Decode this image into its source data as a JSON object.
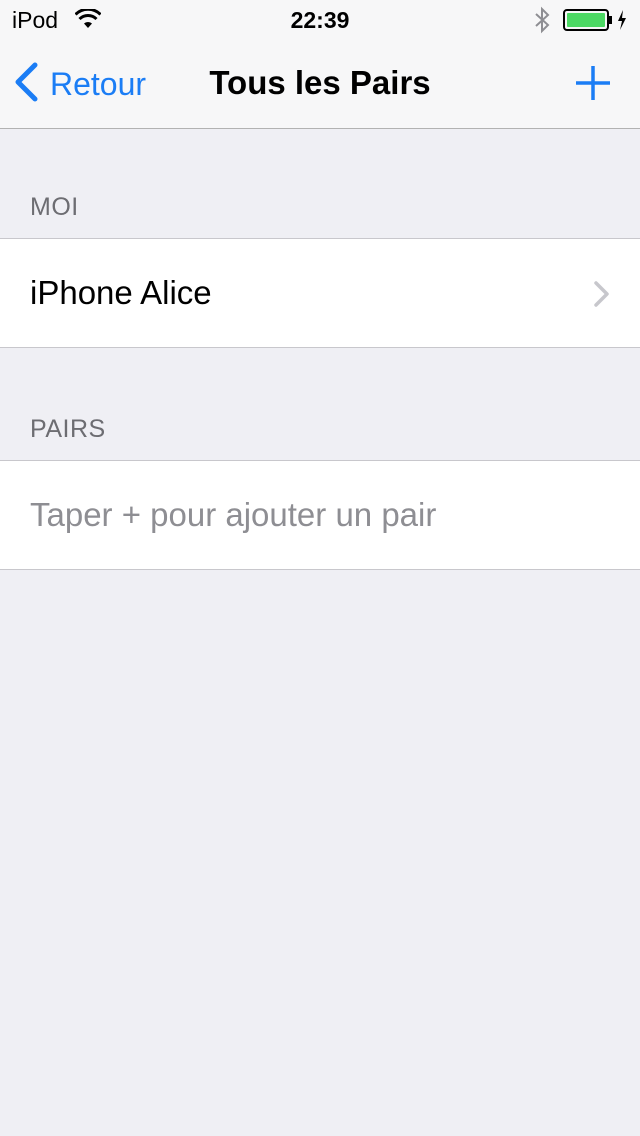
{
  "status_bar": {
    "carrier": "iPod",
    "time": "22:39",
    "wifi_icon": "wifi-icon",
    "bluetooth_icon": "bluetooth-icon",
    "battery_icon": "battery-icon",
    "battery_color": "#4cd964"
  },
  "nav": {
    "back_label": "Retour",
    "title": "Tous les Pairs",
    "add_icon": "plus-icon",
    "accent_color": "#1b7df5"
  },
  "sections": [
    {
      "header": "MOI",
      "rows": [
        {
          "label": "iPhone Alice",
          "disclosure": true
        }
      ]
    },
    {
      "header": "PAIRS",
      "rows": [
        {
          "placeholder": "Taper + pour ajouter un pair"
        }
      ]
    }
  ]
}
